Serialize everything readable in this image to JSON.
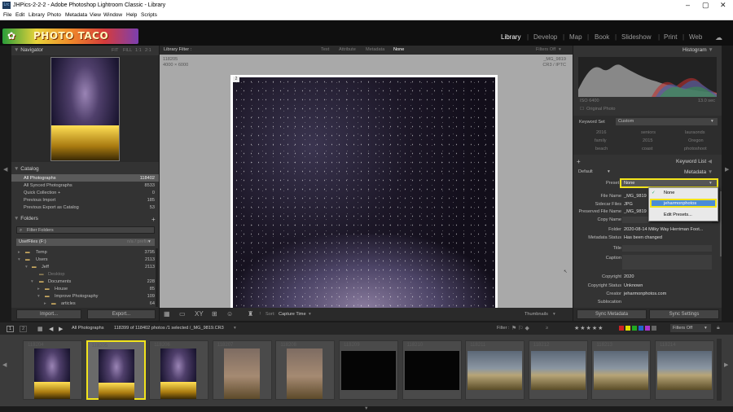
{
  "window": {
    "title": "JHPics-2-2-2 - Adobe Photoshop Lightroom Classic - Library",
    "app_badge": "Lrc"
  },
  "menu": [
    "File",
    "Edit",
    "Library",
    "Photo",
    "Metadata",
    "View",
    "Window",
    "Help",
    "Scripts"
  ],
  "logo": "PHOTO TACO",
  "modules": [
    "Library",
    "Develop",
    "Map",
    "Book",
    "Slideshow",
    "Print",
    "Web"
  ],
  "active_module": "Library",
  "navigator": {
    "title": "Navigator",
    "zoom": [
      "FIT",
      "FILL",
      "1:1",
      "2:1"
    ]
  },
  "catalog": {
    "title": "Catalog",
    "items": [
      {
        "label": "All Photographs",
        "count": "118402"
      },
      {
        "label": "All Synced Photographs",
        "count": "8533"
      },
      {
        "label": "Quick Collection +",
        "count": "0"
      },
      {
        "label": "Previous Import",
        "count": "185"
      },
      {
        "label": "Previous Export as Catalog",
        "count": "53"
      }
    ]
  },
  "folders": {
    "title": "Folders",
    "filter": "Filter Folders",
    "volume": "UsefFiles (F:)",
    "volume_info": "n/a / prefix",
    "items": [
      {
        "label": "Temp",
        "count": "3795",
        "indent": 0
      },
      {
        "label": "Users",
        "count": "2113",
        "indent": 0
      },
      {
        "label": "Jeff",
        "count": "2113",
        "indent": 1
      },
      {
        "label": "Desktop",
        "count": "",
        "indent": 2
      },
      {
        "label": "Documents",
        "count": "228",
        "indent": 2
      },
      {
        "label": "House",
        "count": "85",
        "indent": 3
      },
      {
        "label": "Improve Photography",
        "count": "109",
        "indent": 3
      },
      {
        "label": "articles",
        "count": "64",
        "indent": 4
      }
    ]
  },
  "left_buttons": {
    "import": "Import...",
    "export": "Export..."
  },
  "filter_bar": {
    "label": "Library Filter :",
    "options": [
      "Text",
      "Attribute",
      "Metadata",
      "None"
    ],
    "active": "None",
    "filters_off": "Filters Off"
  },
  "loupe": {
    "left_info": [
      "118205",
      "4000 × 6000"
    ],
    "right_info": [
      "_MG_9819",
      "CR3 / IPTC"
    ],
    "badge": "2"
  },
  "toolbar": {
    "sort_label": "Sort:",
    "sort_value": "Capture Time",
    "thumbs_label": "Thumbnails"
  },
  "histogram": {
    "title": "Histogram",
    "iso": "ISO 6400",
    "shutter": "13.0 sec",
    "original": "Original Photo"
  },
  "keywords": {
    "set_label": "Keyword Set",
    "set_value": "Custom",
    "grid": [
      "2016",
      "seniors",
      "lauraonds",
      "family",
      "2015",
      "Oregon",
      "beach",
      "coast",
      "photoshoot"
    ]
  },
  "keyword_list": {
    "title": "Keyword List"
  },
  "metadata": {
    "title": "Metadata",
    "preset_mode": "Default",
    "preset_label": "Preset",
    "preset_value": "None",
    "dropdown": {
      "items": [
        "None",
        "jeharmonphotos",
        "Edit Presets..."
      ],
      "checked": "None",
      "highlighted": "jeharmonphotos"
    },
    "fields": [
      {
        "label": "File Name",
        "value": "_MG_9819"
      },
      {
        "label": "Sidecar Files",
        "value": "JPG"
      },
      {
        "label": "Preserved File Name",
        "value": "_MG_9819"
      },
      {
        "label": "Copy Name",
        "value": ""
      },
      {
        "label": "Folder",
        "value": "2020-08-14 Milky Way Herriman Foot..."
      },
      {
        "label": "Metadata Status",
        "value": "Has been changed"
      },
      {
        "label": "Title",
        "value": ""
      },
      {
        "label": "Caption",
        "value": ""
      },
      {
        "label": "Copyright",
        "value": "2020"
      },
      {
        "label": "Copyright Status",
        "value": "Unknown"
      },
      {
        "label": "Creator",
        "value": "jeharmonphotos.com"
      },
      {
        "label": "Sublocation",
        "value": ""
      }
    ]
  },
  "right_buttons": {
    "sync_meta": "Sync Metadata",
    "sync_set": "Sync Settings"
  },
  "filmstrip": {
    "pages": [
      "1",
      "2"
    ],
    "source": "All Photographs",
    "info": "118399 of 118402 photos /1 selected /_MG_9819.CR3",
    "filter_label": "Filter :",
    "filters_off": "Filters Off",
    "thumbs": [
      {
        "num": "118204",
        "type": "night"
      },
      {
        "num": "118205",
        "type": "night"
      },
      {
        "num": "118206",
        "type": "night"
      },
      {
        "num": "118207",
        "type": "dusk"
      },
      {
        "num": "118208",
        "type": "dusk"
      },
      {
        "num": "118209",
        "type": "black"
      },
      {
        "num": "118210",
        "type": "black"
      },
      {
        "num": "118211",
        "type": "land"
      },
      {
        "num": "118212",
        "type": "land"
      },
      {
        "num": "118213",
        "type": "land"
      },
      {
        "num": "118214",
        "type": "land"
      }
    ],
    "selected_index": 1
  },
  "colors": {
    "accent": "#f2e41c",
    "panel": "#333333",
    "bg": "#1b1b1b"
  }
}
